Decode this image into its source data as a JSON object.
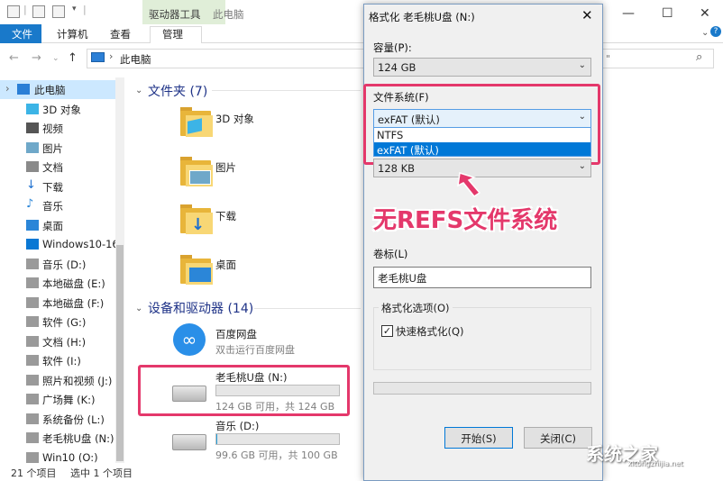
{
  "window": {
    "title": "此电脑",
    "drive_tools_tab": "驱动器工具"
  },
  "ribbon": {
    "file": "文件",
    "computer": "计算机",
    "view": "查看",
    "manage": "管理"
  },
  "address": {
    "path": "此电脑",
    "search_placeholder": "\""
  },
  "sidebar": {
    "items": [
      {
        "label": "此电脑",
        "icon": "computer-icon",
        "selected": true
      },
      {
        "label": "3D 对象",
        "icon": "3d-objects-icon"
      },
      {
        "label": "视频",
        "icon": "video-icon"
      },
      {
        "label": "图片",
        "icon": "pictures-icon"
      },
      {
        "label": "文档",
        "icon": "documents-icon"
      },
      {
        "label": "下载",
        "icon": "download-icon"
      },
      {
        "label": "音乐",
        "icon": "music-icon"
      },
      {
        "label": "桌面",
        "icon": "desktop-icon"
      },
      {
        "label": "Windows10-16",
        "icon": "windows-drive-icon"
      },
      {
        "label": "音乐 (D:)",
        "icon": "drive-icon"
      },
      {
        "label": "本地磁盘 (E:)",
        "icon": "drive-icon"
      },
      {
        "label": "本地磁盘 (F:)",
        "icon": "drive-icon"
      },
      {
        "label": "软件 (G:)",
        "icon": "drive-icon"
      },
      {
        "label": "文档 (H:)",
        "icon": "drive-icon"
      },
      {
        "label": "软件 (I:)",
        "icon": "drive-icon"
      },
      {
        "label": "照片和视频 (J:)",
        "icon": "drive-icon"
      },
      {
        "label": "广场舞 (K:)",
        "icon": "drive-icon"
      },
      {
        "label": "系统备份 (L:)",
        "icon": "drive-icon"
      },
      {
        "label": "老毛桃U盘 (N:)",
        "icon": "usb-drive-icon"
      },
      {
        "label": "Win10 (O:)",
        "icon": "drive-icon"
      }
    ]
  },
  "folders_section": {
    "title": "文件夹 (7)",
    "items": [
      "3D 对象",
      "图片",
      "下载",
      "桌面"
    ]
  },
  "devices_section": {
    "title": "设备和驱动器 (14)",
    "baidu": {
      "name": "百度网盘",
      "sub": "双击运行百度网盘"
    },
    "usb": {
      "name": "老毛桃U盘 (N:)",
      "free": "124 GB 可用，共 124 GB",
      "used_fraction": 0.0
    },
    "music": {
      "name": "音乐 (D:)",
      "free": "99.6 GB 可用，共 100 GB",
      "used_fraction": 0.004
    }
  },
  "status": {
    "count": "21 个项目",
    "selected": "选中 1 个项目"
  },
  "dialog": {
    "title": "格式化 老毛桃U盘 (N:)",
    "capacity_label": "容量(P):",
    "capacity_value": "124 GB",
    "fs_label": "文件系统(F)",
    "fs_value": "exFAT (默认)",
    "fs_options": [
      "NTFS",
      "exFAT (默认)"
    ],
    "alloc_value": "128 KB",
    "callout": "无REFS文件系统",
    "volume_label": "卷标(L)",
    "volume_value": "老毛桃U盘",
    "options_label": "格式化选项(O)",
    "quick_format": "快速格式化(Q)",
    "quick_checked": "✓",
    "start": "开始(S)",
    "close": "关闭(C)"
  },
  "watermark": {
    "text": "系统之家",
    "sub": "xitongzhijia.net"
  },
  "colors": {
    "accent": "#1979ca",
    "highlight": "#e4386b",
    "selection": "#0078d7"
  }
}
